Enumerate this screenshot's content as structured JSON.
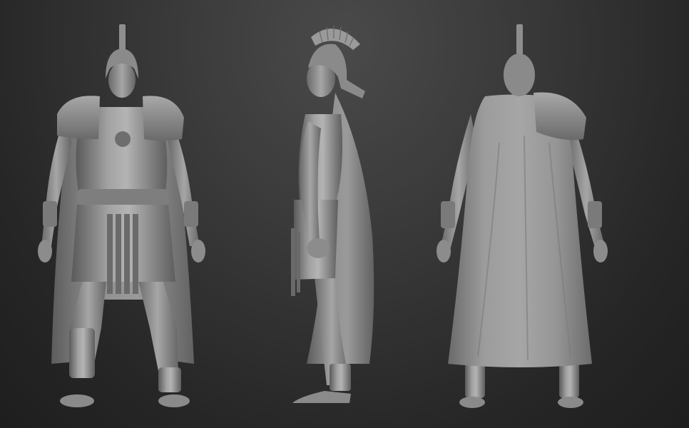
{
  "scene": {
    "background_top": "#484848",
    "background_bottom": "#1f1f1f",
    "material_base": "#8f8f8f",
    "material_highlight": "#c2c2c2",
    "material_shadow": "#4e4e4e",
    "views": [
      {
        "id": "front",
        "subject": "roman-legionary-sculpt"
      },
      {
        "id": "side",
        "subject": "roman-legionary-sculpt"
      },
      {
        "id": "back",
        "subject": "roman-legionary-sculpt"
      }
    ]
  }
}
